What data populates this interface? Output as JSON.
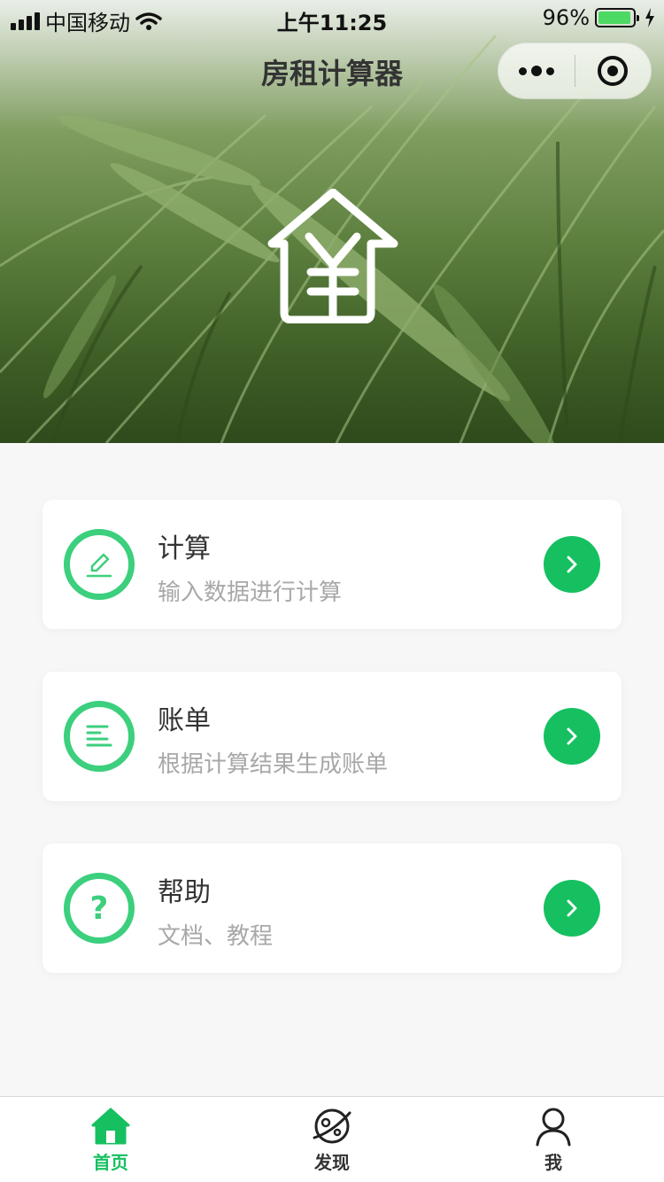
{
  "status_bar": {
    "carrier": "中国移动",
    "time": "上午11:25",
    "battery_percent": "96%",
    "battery_level": 0.96
  },
  "nav": {
    "title": "房租计算器",
    "more_icon": "more-dots-icon",
    "close_icon": "target-close-icon"
  },
  "hero": {
    "logo_icon": "house-yen-icon"
  },
  "cards": [
    {
      "title": "计算",
      "subtitle": "输入数据进行计算",
      "icon": "pencil-icon"
    },
    {
      "title": "账单",
      "subtitle": "根据计算结果生成账单",
      "icon": "list-lines-icon"
    },
    {
      "title": "帮助",
      "subtitle": "文档、教程",
      "icon": "question-icon",
      "glyph": "?"
    }
  ],
  "tabbar": {
    "items": [
      {
        "label": "首页",
        "icon": "home-icon",
        "active": true
      },
      {
        "label": "发现",
        "icon": "planet-icon",
        "active": false
      },
      {
        "label": "我",
        "icon": "user-icon",
        "active": false
      }
    ]
  },
  "colors": {
    "accent": "#16c060",
    "ring": "#3ccf7d",
    "subtitle": "#a8a8a8",
    "page_bg": "#f7f7f7"
  }
}
